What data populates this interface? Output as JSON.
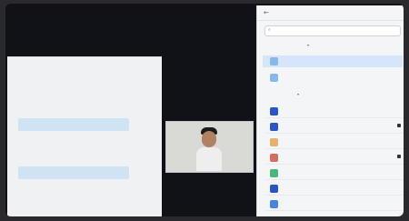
{
  "meeting": {
    "top_hint": "",
    "shared_doc_label": "",
    "video_name": ""
  },
  "participants_panel": {
    "title": "",
    "search_placeholder": "",
    "room": {
      "title": "",
      "move_label": "",
      "delete_label": "",
      "rooms": [
        {
          "name": "",
          "color": "#86b8ea"
        },
        {
          "name": "",
          "color": "#86b8ea"
        }
      ]
    },
    "level_header": "",
    "participants": [
      {
        "name": "",
        "color": "#2b56c7",
        "status": false
      },
      {
        "name": "",
        "color": "#2b56c7",
        "status": true
      },
      {
        "name": "",
        "color": "#e8b06d",
        "status": false
      },
      {
        "name": "",
        "color": "#d56d62",
        "status": true
      },
      {
        "name": "",
        "color": "#48b77c",
        "status": false
      },
      {
        "name": "",
        "color": "#2b56c7",
        "status": false
      },
      {
        "name": "",
        "color": "#4b84e0",
        "status": false
      }
    ]
  }
}
